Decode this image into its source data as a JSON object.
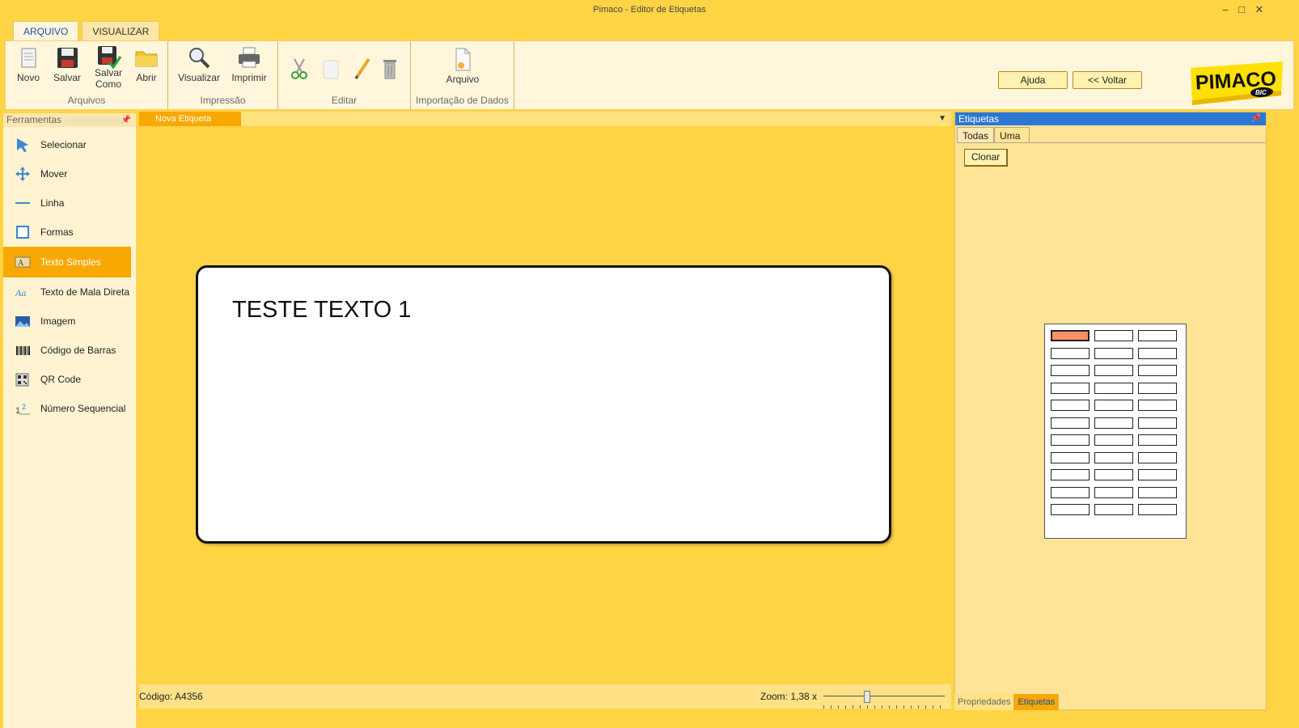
{
  "window": {
    "title": "Pimaco - Editor de Etiquetas",
    "controls": {
      "minimize": "–",
      "maximize": "□",
      "close": "✕"
    }
  },
  "ribbon_tabs": [
    {
      "label": "ARQUIVO",
      "active": true
    },
    {
      "label": "VISUALIZAR",
      "active": false
    }
  ],
  "ribbon": {
    "arquivos": {
      "label": "Arquivos",
      "buttons": {
        "novo": "Novo",
        "salvar": "Salvar",
        "salvar_como_1": "Salvar",
        "salvar_como_2": "Como",
        "abrir": "Abrir"
      }
    },
    "impressao": {
      "label": "Impressão",
      "buttons": {
        "visualizar": "Visualizar",
        "imprimir": "Imprimir"
      }
    },
    "editar": {
      "label": "Editar"
    },
    "importacao": {
      "label": "Importação de Dados",
      "buttons": {
        "arquivo": "Arquivo"
      }
    },
    "ajuda": "Ajuda",
    "voltar": "<< Voltar",
    "logo_text": "PIMACO",
    "logo_sub": "BIC"
  },
  "tools_panel": {
    "title": "Ferramentas",
    "items": [
      {
        "label": "Selecionar",
        "icon": "pointer-icon"
      },
      {
        "label": "Mover",
        "icon": "move-icon"
      },
      {
        "label": "Linha",
        "icon": "line-icon"
      },
      {
        "label": "Formas",
        "icon": "shapes-icon"
      },
      {
        "label": "Texto Simples",
        "icon": "text-icon",
        "active": true
      },
      {
        "label": "Texto de Mala Direta",
        "icon": "mail-merge-text-icon"
      },
      {
        "label": "Imagem",
        "icon": "image-icon"
      },
      {
        "label": "Código de Barras",
        "icon": "barcode-icon"
      },
      {
        "label": "QR Code",
        "icon": "qr-code-icon"
      },
      {
        "label": "Número Sequencial",
        "icon": "sequential-number-icon"
      }
    ]
  },
  "document": {
    "tab": "Nova Etiqueta",
    "label_text": "TESTE TEXTO 1"
  },
  "status": {
    "code": "Código: A4356",
    "zoom": "Zoom: 1,38 x",
    "zoom_slider_fraction": 0.35
  },
  "labels_panel": {
    "title": "Etiquetas",
    "tabs": [
      {
        "label": "Todas",
        "active": false
      },
      {
        "label": "Uma",
        "active": true
      }
    ],
    "clone_button": "Clonar",
    "sheet": {
      "rows": 11,
      "cols": 3,
      "selected_index": 0
    }
  },
  "bottom_tabs": [
    {
      "label": "Propriedades",
      "active": false
    },
    {
      "label": "Etiquetas",
      "active": true
    }
  ],
  "colors": {
    "app_background": "#ffd445",
    "accent_orange": "#f8a800",
    "panel_header_blue": "#2d77d4",
    "ribbon_background": "#fff6dc",
    "selected_label": "#f7906a"
  }
}
